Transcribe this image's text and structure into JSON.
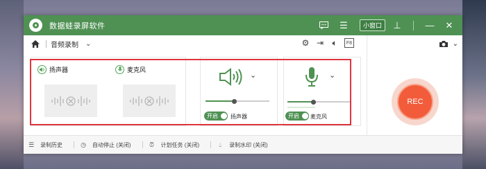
{
  "window": {
    "title": "数据蛙录屏软件",
    "mini_window_label": "小窗口"
  },
  "toolbar": {
    "mode_label": "音频录制",
    "fullscreen_box": "F8"
  },
  "devices": {
    "speaker_label": "扬声器",
    "mic_label": "麦克风"
  },
  "speaker_panel": {
    "volume": 0.45,
    "toggle_label": "开启",
    "caption": "扬声器"
  },
  "mic_panel": {
    "volume": 0.4,
    "toggle_label": "开启",
    "caption": "麦克风"
  },
  "record": {
    "label": "REC"
  },
  "statusbar": {
    "history": "录制历史",
    "auto_stop": "自动停止 (关闭)",
    "schedule": "计划任务 (关闭)",
    "watermark": "录制水印 (关闭)"
  },
  "colors": {
    "brand_green": "#4f9153",
    "rec_orange": "#f25c3a",
    "highlight_red": "#e0343d"
  }
}
